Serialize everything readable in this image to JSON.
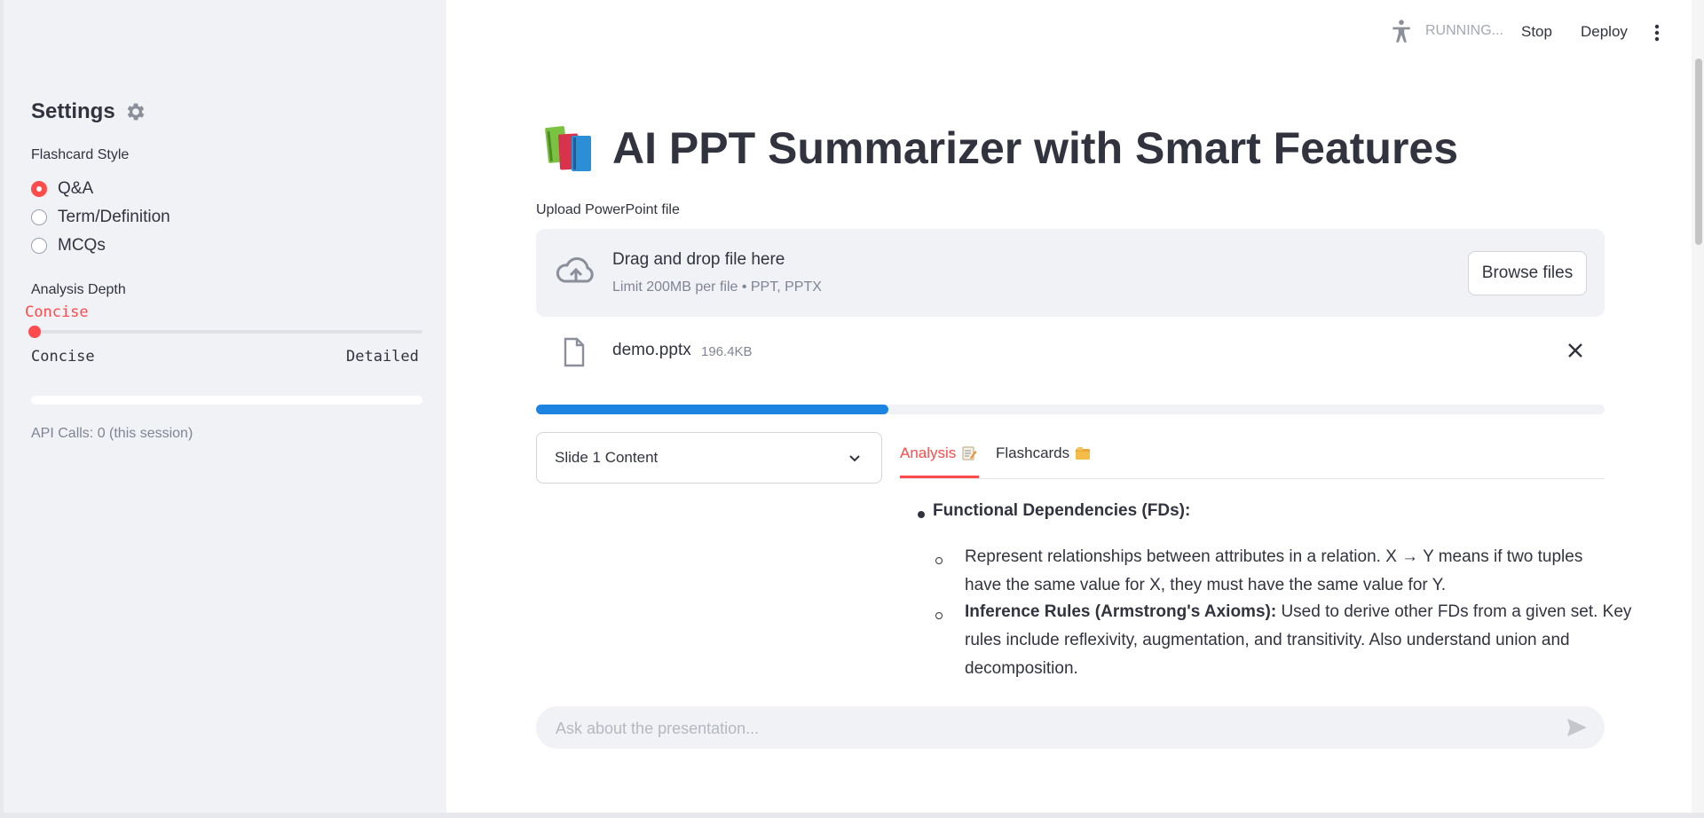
{
  "sidebar": {
    "title": "Settings",
    "flashcard_style_label": "Flashcard Style",
    "flashcard_options": [
      "Q&A",
      "Term/Definition",
      "MCQs"
    ],
    "flashcard_selected": "Q&A",
    "analysis_depth_label": "Analysis Depth",
    "slider_value": "Concise",
    "slider_min_label": "Concise",
    "slider_max_label": "Detailed",
    "api_calls": "API Calls: 0 (this session)"
  },
  "topbar": {
    "status": "RUNNING...",
    "stop_label": "Stop",
    "deploy_label": "Deploy"
  },
  "main": {
    "title": "AI PPT Summarizer with Smart Features",
    "upload_label": "Upload PowerPoint file",
    "dropzone_title": "Drag and drop file here",
    "dropzone_sub": "Limit 200MB per file • PPT, PPTX",
    "browse_label": "Browse files",
    "file_name": "demo.pptx",
    "file_size": "196.4KB",
    "progress_fraction": 0.33,
    "slide_select_value": "Slide 1 Content",
    "tabs": [
      {
        "label": "Analysis",
        "active": true
      },
      {
        "label": "Flashcards",
        "active": false
      }
    ],
    "content": {
      "heading": "Functional Dependencies (FDs):",
      "item1_line1": "Represent relationships between attributes in a relation. X → Y means if two tuples",
      "item1_line2": "have the same value for X, they must have the same value for Y.",
      "item2_bold": "Inference Rules (Armstrong's Axioms):",
      "item2_line1_rest": " Used to derive other FDs from a given set. Key",
      "item2_line2": "rules include reflexivity, augmentation, and transitivity. Also understand union and",
      "item2_line3": "decomposition."
    },
    "chat_placeholder": "Ask about the presentation..."
  },
  "colors": {
    "accent": "#ff4b4b",
    "progress": "#1c83e1",
    "sidebar_bg": "#f0f2f6"
  }
}
